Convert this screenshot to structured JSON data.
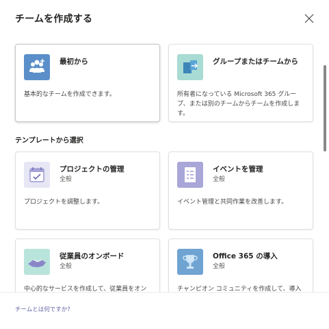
{
  "dialog": {
    "title": "チームを作成する"
  },
  "cards_top": [
    {
      "title": "最初から",
      "description": "基本的なチームを作成できます。",
      "icon": "people-icon",
      "icon_bg": "#5b8fc9"
    },
    {
      "title": "グループまたはチームから",
      "description": "所有者になっている Microsoft 365 グループ、または別のチームからチームを作成します。",
      "icon": "group-arrow-icon",
      "icon_bg": "#a8dbd3"
    }
  ],
  "templates_section": {
    "label": "テンプレートから選択"
  },
  "templates": [
    {
      "title": "プロジェクトの管理",
      "category": "全般",
      "description": "プロジェクトを調整します。",
      "icon": "calendar-check-icon",
      "icon_bg": "#e6e6f5"
    },
    {
      "title": "イベントを管理",
      "category": "全般",
      "description": "イベント管理と共同作業を改善します。",
      "icon": "checklist-icon",
      "icon_bg": "#a9a6d8"
    },
    {
      "title": "従業員のオンボード",
      "category": "全般",
      "description": "中心的なサービスを作成して、従業員をオンボード",
      "icon": "handshake-icon",
      "icon_bg": "#b9e4dc"
    },
    {
      "title": "Office 365 の導入",
      "category": "全般",
      "description": "チャンピオン コミュニティを作成して、導入を推進し",
      "icon": "trophy-icon",
      "icon_bg": "#6fa4d2"
    }
  ],
  "footer": {
    "link": "チームとは何ですか?"
  },
  "colors": {
    "accent": "#6264a7",
    "border": "#e1dfdd"
  }
}
